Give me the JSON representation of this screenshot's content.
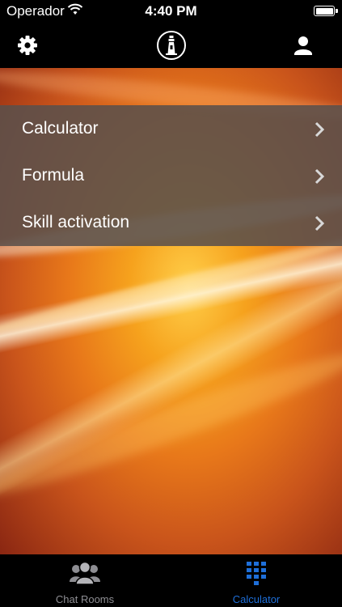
{
  "status_bar": {
    "carrier": "Operador",
    "time": "4:40 PM"
  },
  "nav": {
    "left_icon": "gear-icon",
    "center_icon": "lighthouse-info-icon",
    "right_icon": "profile-icon"
  },
  "menu": {
    "items": [
      {
        "label": "Calculator"
      },
      {
        "label": "Formula"
      },
      {
        "label": "Skill activation"
      }
    ]
  },
  "tab_bar": {
    "tabs": [
      {
        "label": "Chat Rooms",
        "icon": "people-group-icon",
        "selected": false
      },
      {
        "label": "Calculator",
        "icon": "keypad-icon",
        "selected": true
      }
    ]
  },
  "colors": {
    "accent": "#1e6fd9",
    "inactive": "#8e8e93"
  }
}
